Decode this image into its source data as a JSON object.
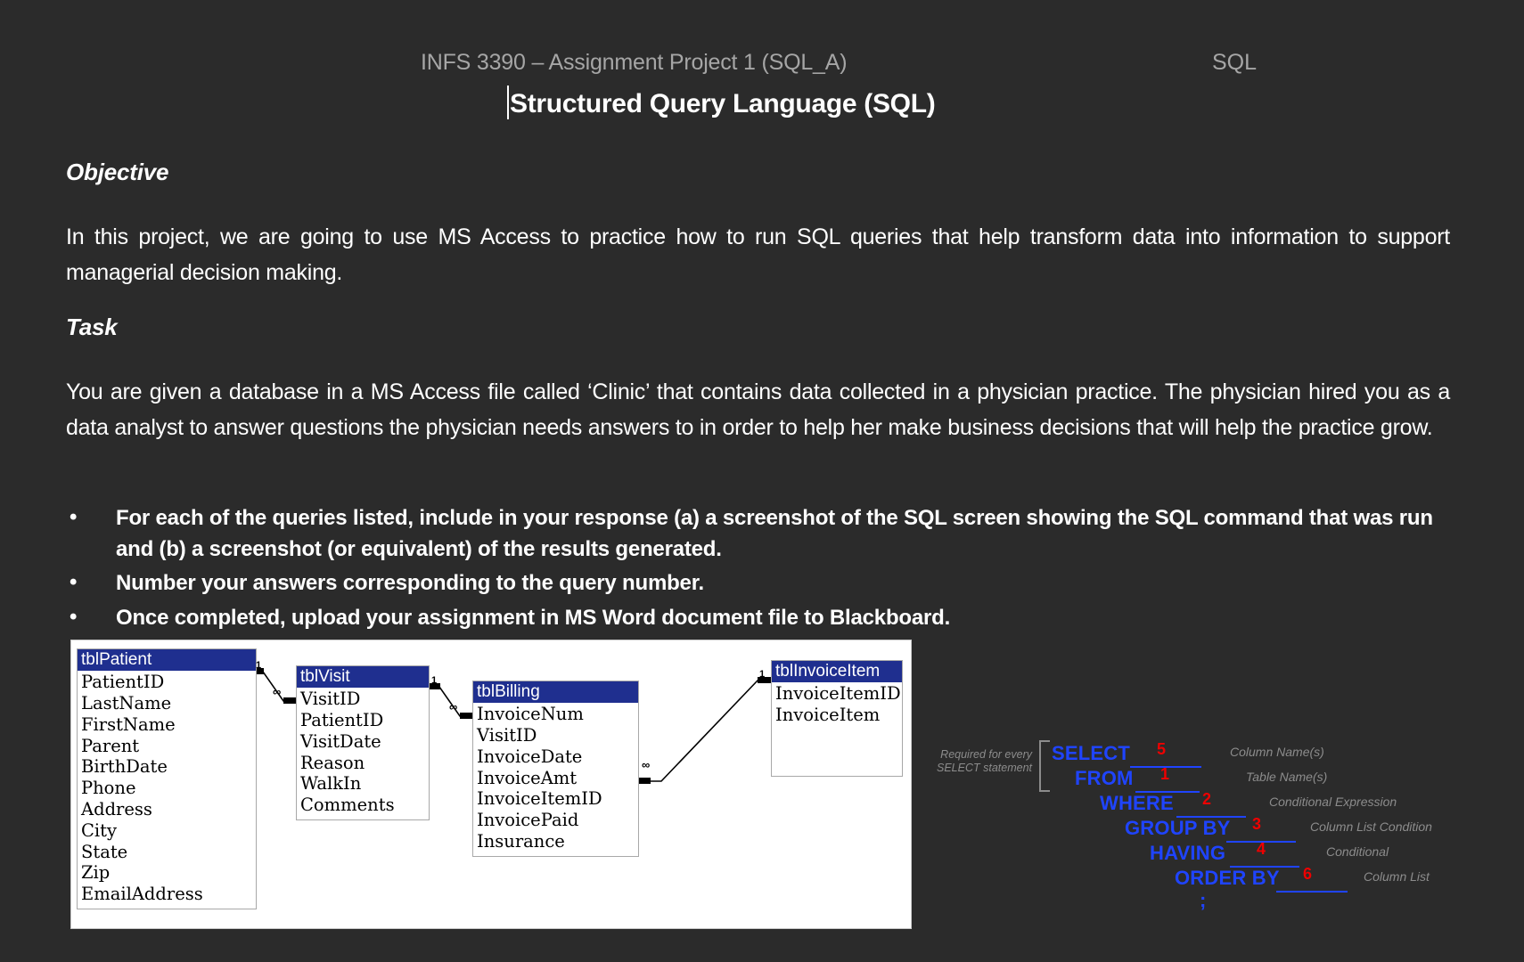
{
  "header": {
    "course": "INFS 3390 – Assignment Project 1 (SQL_A)",
    "right_label": "SQL",
    "title": "Structured Query Language (SQL)"
  },
  "sections": {
    "objective_heading": "Objective",
    "objective_body": "In this project, we are going to use MS Access to practice how to run SQL queries that help transform data into information to support managerial decision making.",
    "task_heading": "Task",
    "task_body": "You are given a database in a MS Access file called ‘Clinic’ that contains data collected in a physician practice. The physician hired you as a data analyst to answer questions the physician needs answers to in order to help her make business decisions that will help the practice grow."
  },
  "bullets": [
    "For each of the queries listed, include in your response (a) a screenshot of the SQL screen showing the SQL command that was run and (b) a screenshot (or equivalent) of the results generated.",
    "Number your answers corresponding to the query number.",
    "Once completed, upload your assignment in MS Word document file to Blackboard."
  ],
  "bullet_marker": "•",
  "erd": {
    "tables": [
      {
        "name": "tblPatient",
        "fields": [
          "PatientID",
          "LastName",
          "FirstName",
          "Parent",
          "BirthDate",
          "Phone",
          "Address",
          "City",
          "State",
          "Zip",
          "EmailAddress"
        ]
      },
      {
        "name": "tblVisit",
        "fields": [
          "VisitID",
          "PatientID",
          "VisitDate",
          "Reason",
          "WalkIn",
          "Comments"
        ]
      },
      {
        "name": "tblBilling",
        "fields": [
          "InvoiceNum",
          "VisitID",
          "InvoiceDate",
          "InvoiceAmt",
          "InvoiceItemID",
          "InvoicePaid",
          "Insurance"
        ]
      },
      {
        "name": "tblInvoiceItem",
        "fields": [
          "InvoiceItemID",
          "InvoiceItem"
        ]
      }
    ],
    "relationships": [
      {
        "one": "1",
        "many": "∞"
      },
      {
        "one": "1",
        "many": "∞"
      },
      {
        "one": "1",
        "many": "∞"
      }
    ],
    "header_color": "#1f2f8f"
  },
  "sql_diagram": {
    "required_note_line1": "Required for every",
    "required_note_line2": "SELECT statement",
    "keyword_color": "#1f44ff",
    "number_color": "#ee0000",
    "clauses": [
      {
        "keyword": "SELECT",
        "order": "5",
        "annotation": "Column Name(s)"
      },
      {
        "keyword": "FROM",
        "order": "1",
        "annotation": "Table Name(s)"
      },
      {
        "keyword": "WHERE",
        "order": "2",
        "annotation": "Conditional Expression"
      },
      {
        "keyword": "GROUP BY",
        "order": "3",
        "annotation": "Column List Condition"
      },
      {
        "keyword": "HAVING",
        "order": "4",
        "annotation": "Conditional"
      },
      {
        "keyword": "ORDER BY",
        "order": "6",
        "annotation": "Column List"
      }
    ],
    "terminator": ";"
  }
}
